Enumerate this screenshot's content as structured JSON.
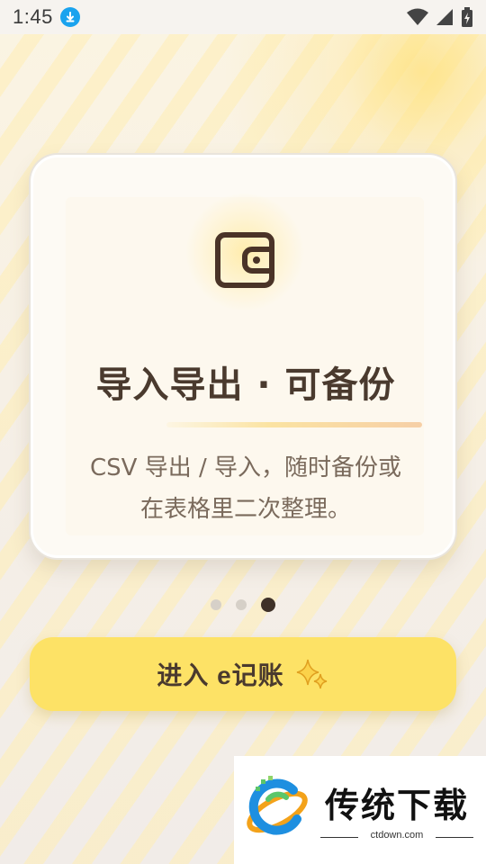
{
  "status_bar": {
    "time": "1:45",
    "icons": [
      "download-icon",
      "wifi-icon",
      "signal-icon",
      "battery-icon"
    ]
  },
  "card": {
    "icon": "wallet-icon",
    "title": "导入导出 · 可备份",
    "description_line1": "CSV 导出 / 导入，随时备份或",
    "description_line2": "在表格里二次整理。"
  },
  "pager": {
    "total": 3,
    "active_index": 2
  },
  "cta": {
    "label": "进入 e记账",
    "icon": "sparkle-icon"
  },
  "watermark": {
    "text": "传统下载",
    "url": "ctdown.com"
  },
  "colors": {
    "accent": "#fde266",
    "text_dark": "#4a3a2e",
    "text_muted": "#7a6a5c",
    "download_badge": "#1aa3ee"
  }
}
